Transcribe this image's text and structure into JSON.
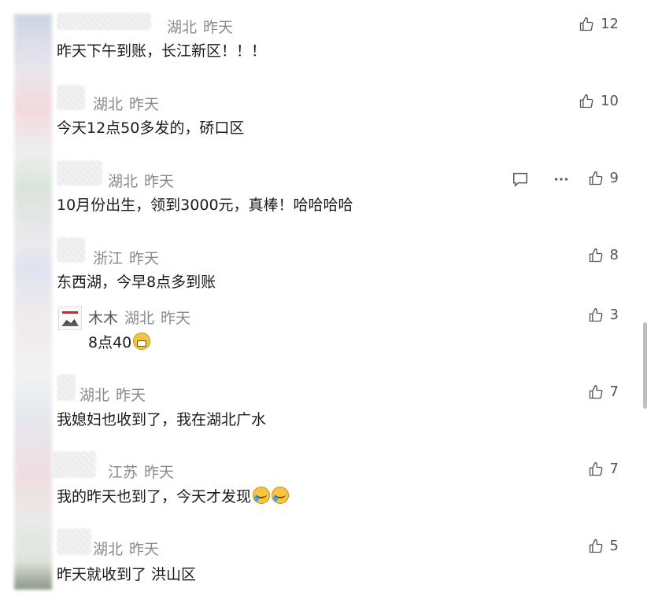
{
  "comments": [
    {
      "region": "湖北",
      "time": "昨天",
      "text": "昨天下午到账，长江新区！！！",
      "likes": "12"
    },
    {
      "region": "湖北",
      "time": "昨天",
      "text": "今天12点50多发的，硚口区",
      "likes": "10"
    },
    {
      "region": "湖北",
      "time": "昨天",
      "text": "10月份出生，领到3000元，真棒！哈哈哈哈",
      "likes": "9"
    },
    {
      "region": "浙江",
      "time": "昨天",
      "text": "东西湖，今早8点多到账",
      "likes": "8"
    },
    {
      "region": "湖北",
      "time": "昨天",
      "text": "我媳妇也收到了，我在湖北广水",
      "likes": "7"
    },
    {
      "region": "江苏",
      "time": "昨天",
      "text": "我的昨天也到了，今天才发现",
      "likes": "7"
    },
    {
      "region": "湖北",
      "time": "昨天",
      "text": "昨天就收到了 洪山区",
      "likes": "5"
    }
  ],
  "reply": {
    "username": "木木",
    "region": "湖北",
    "time": "昨天",
    "text": "8点40",
    "likes": "3"
  },
  "icons": {
    "like": "thumbs-up-icon",
    "reply": "comment-icon",
    "more": "more-dots-icon",
    "emoji_grin": "grinning-face-emoji",
    "emoji_cry": "crying-laughing-emoji"
  }
}
